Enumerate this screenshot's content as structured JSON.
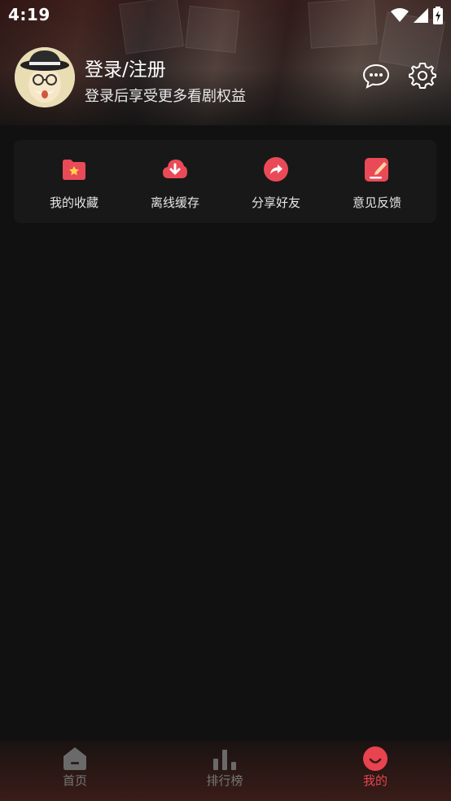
{
  "status_bar": {
    "time": "4:19"
  },
  "profile": {
    "title": "登录/注册",
    "subtitle": "登录后享受更多看剧权益"
  },
  "quick_actions": [
    {
      "label": "我的收藏",
      "icon": "folder-star-icon"
    },
    {
      "label": "离线缓存",
      "icon": "cloud-download-icon"
    },
    {
      "label": "分享好友",
      "icon": "share-arrow-icon"
    },
    {
      "label": "意见反馈",
      "icon": "edit-note-icon"
    }
  ],
  "bottom_nav": [
    {
      "label": "首页",
      "icon": "home-icon",
      "active": false
    },
    {
      "label": "排行榜",
      "icon": "bar-chart-icon",
      "active": false
    },
    {
      "label": "我的",
      "icon": "smile-icon",
      "active": true
    }
  ],
  "colors": {
    "accent": "#e8434f",
    "background": "#111111",
    "card": "#181818",
    "inactive": "#777777"
  }
}
